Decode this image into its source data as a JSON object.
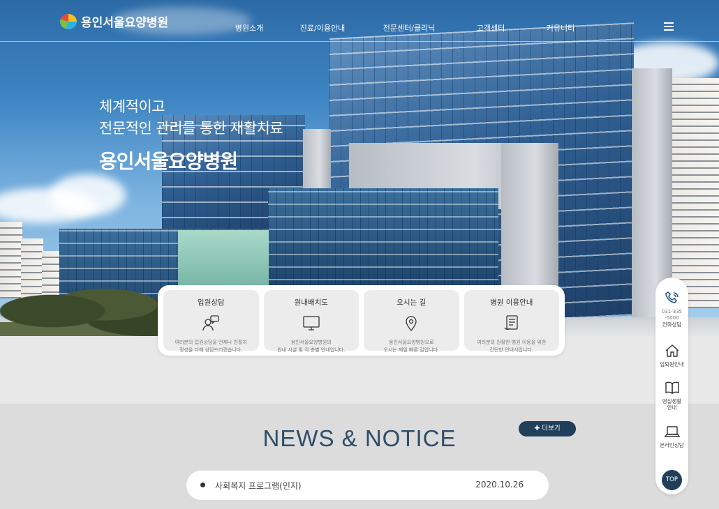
{
  "header": {
    "logo_text": "용인서울요양병원",
    "menu": [
      {
        "label": "병원소개"
      },
      {
        "label": "진료/이용안내"
      },
      {
        "label": "전문센터/클리닉"
      },
      {
        "label": "고객센터"
      },
      {
        "label": "커뮤니티"
      }
    ]
  },
  "hero": {
    "line1": "체계적이고",
    "line2": "전문적인 관리를 통한 재활치료",
    "line3": "용인서울요양병원"
  },
  "quick_menu": [
    {
      "title": "입원상담",
      "icon": "consult-icon",
      "desc1": "여러분의 입원상담을 언제나 친절히",
      "desc2": "정성을 다해 상담드리겠습니다."
    },
    {
      "title": "원내배치도",
      "icon": "monitor-icon",
      "desc1": "용인서울요양병원의",
      "desc2": "원내 시설 및 각 층별 안내입니다."
    },
    {
      "title": "오시는 길",
      "icon": "location-pin-icon",
      "desc1": "용인서울요양병원으로",
      "desc2": "오시는 제일 빠른 길입니다."
    },
    {
      "title": "병원 이용안내",
      "icon": "document-icon",
      "desc1": "여러분의 원활한 병원 이용을 위한",
      "desc2": "간단한 안내서입니다."
    }
  ],
  "news": {
    "title": "NEWS & NOTICE",
    "more_label": "✚ 더보기",
    "items": [
      {
        "text": "사회복지 프로그램(인지)",
        "date": "2020.10.26"
      }
    ]
  },
  "sidebar": {
    "phone_number_line1": "031-335",
    "phone_number_line2": "-5000",
    "items": [
      {
        "label": "전화상담",
        "icon": "phone-icon"
      },
      {
        "label": "입퇴원안내",
        "icon": "home-icon"
      },
      {
        "label_line1": "병실생활",
        "label_line2": "안내",
        "icon": "book-icon"
      },
      {
        "label": "온라인상담",
        "icon": "laptop-icon"
      }
    ],
    "top_label": "TOP"
  },
  "colors": {
    "primary_navy": "#1f3f5b",
    "heading_blue": "#2d4d68",
    "card_gray": "#ececec"
  }
}
